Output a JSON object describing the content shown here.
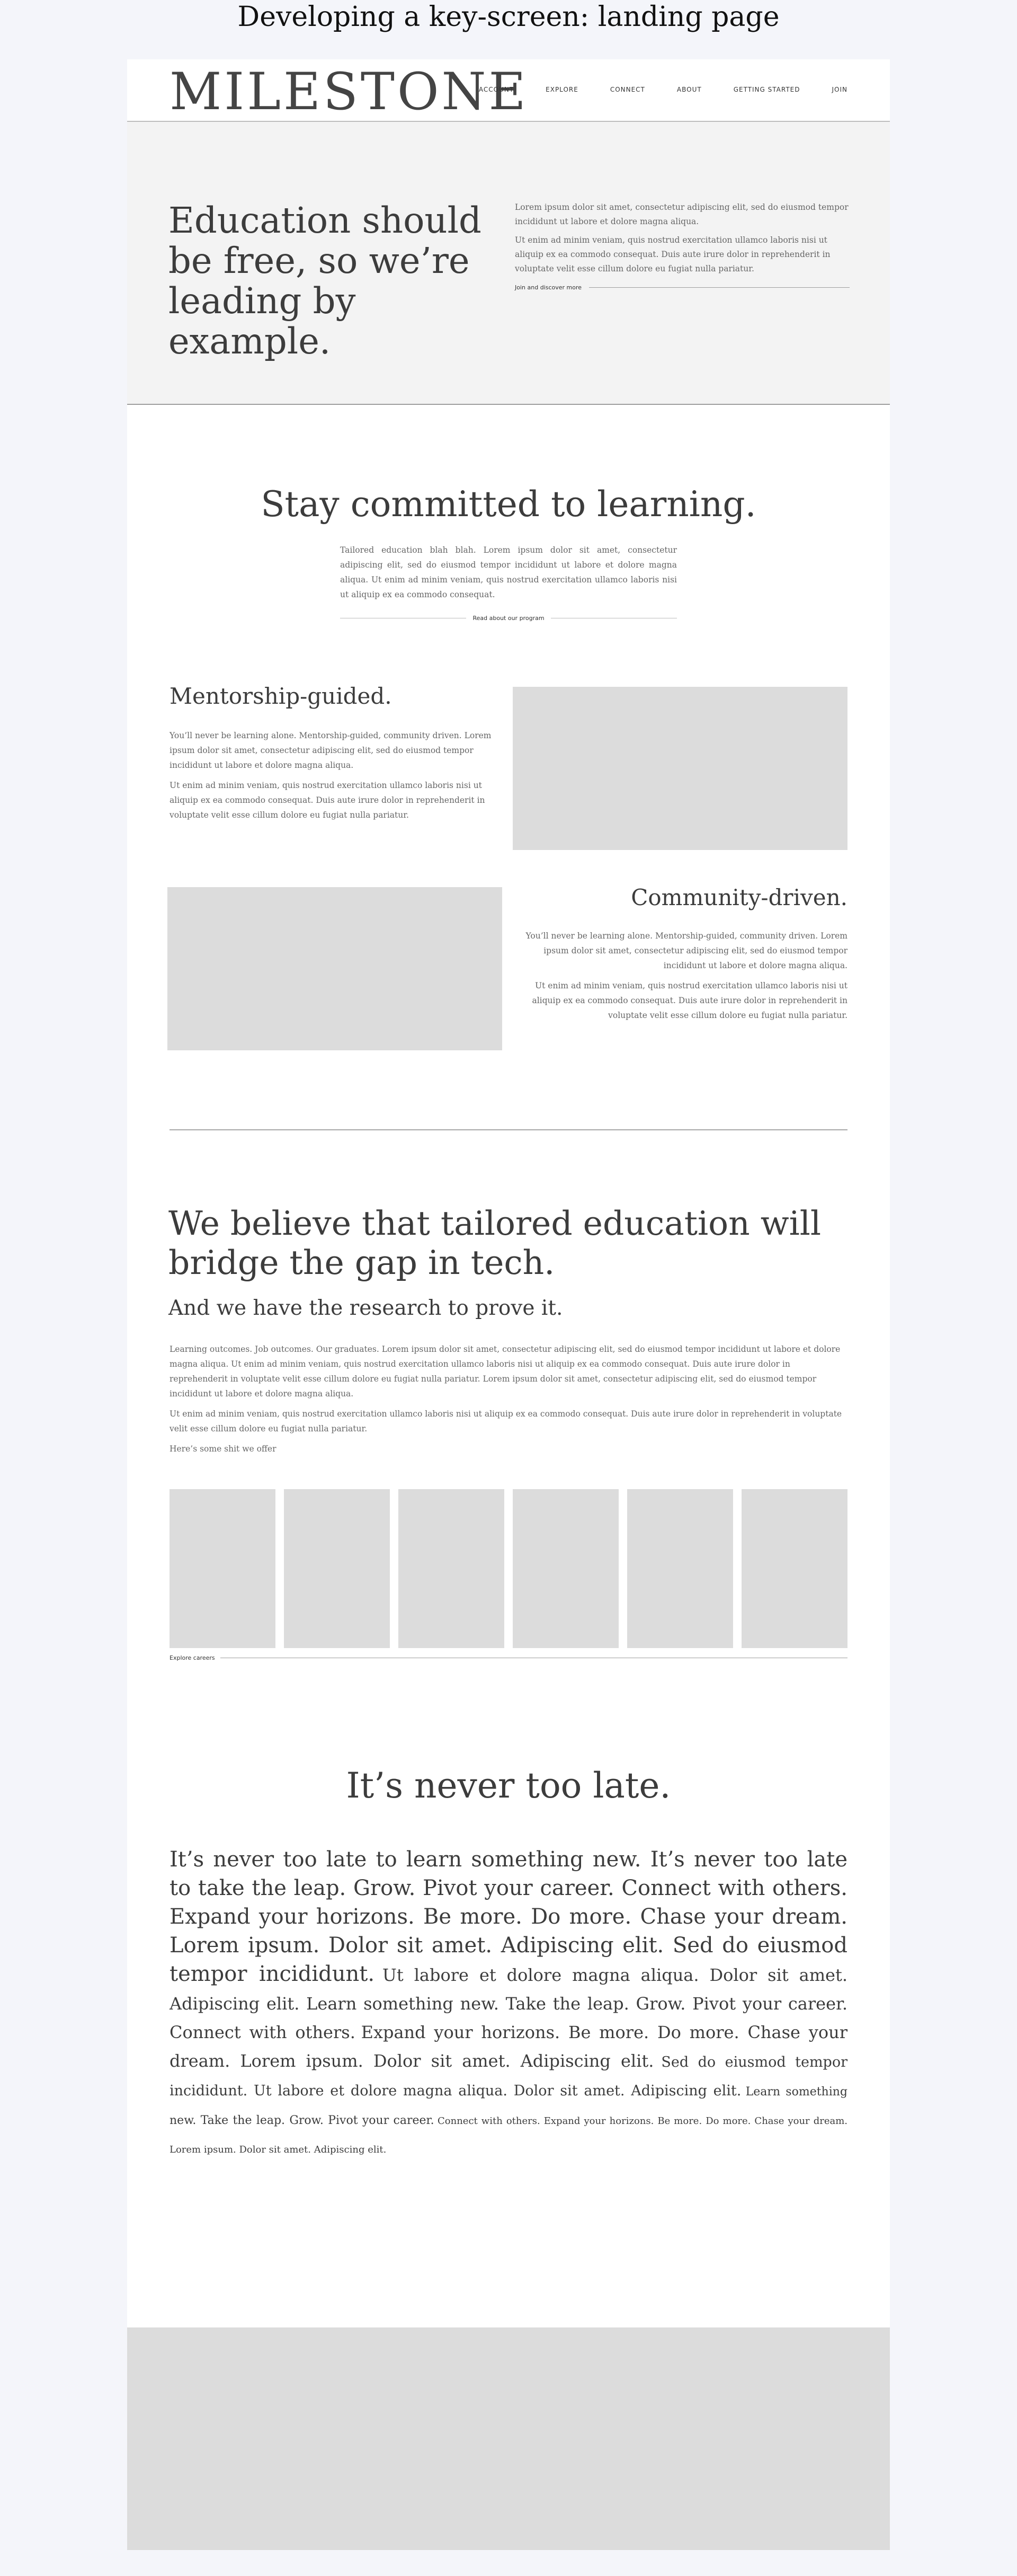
{
  "page_heading": "Developing a key-screen: landing page",
  "header": {
    "logo": "MILESTONE",
    "nav": [
      "ACCOUNT",
      "EXPLORE",
      "CONNECT",
      "ABOUT",
      "GETTING STARTED",
      "JOIN"
    ]
  },
  "hero": {
    "title": "Education should be free, so we’re leading by example.",
    "paragraphs": [
      "Lorem ipsum dolor sit amet, consectetur adipiscing elit, sed do eiusmod tempor incididunt ut labore et dolore magna aliqua.",
      "Ut enim ad minim veniam, quis nostrud exercitation ullamco laboris nisi ut aliquip ex ea commodo consequat. Duis aute irure dolor in reprehenderit in voluptate velit esse cillum dolore eu fugiat nulla pariatur."
    ],
    "link": "Join and discover more"
  },
  "commit": {
    "title": "Stay committed to learning.",
    "copy": "Tailored education blah blah. Lorem ipsum dolor sit amet, consectetur adipiscing elit, sed do eiusmod tempor incididunt ut labore et dolore magna aliqua. Ut enim ad minim veniam, quis nostrud exercitation ullamco laboris nisi ut aliquip ex ea commodo consequat.",
    "link": "Read about our program"
  },
  "features": [
    {
      "title": "Mentorship-guided.",
      "paragraphs": [
        "You’ll never be learning alone. Mentorship-guided, community driven. Lorem ipsum dolor sit amet, consectetur adipiscing elit, sed do eiusmod tempor incididunt ut labore et dolore magna aliqua.",
        "Ut enim ad minim veniam, quis nostrud exercitation ullamco laboris nisi ut aliquip ex ea commodo consequat. Duis aute irure dolor in reprehenderit in voluptate velit esse cillum dolore eu fugiat nulla pariatur."
      ]
    },
    {
      "title": "Community-driven.",
      "paragraphs": [
        "You’ll never be learning alone. Mentorship-guided, community driven. Lorem ipsum dolor sit amet, consectetur adipiscing elit, sed do eiusmod tempor incididunt ut labore et dolore magna aliqua.",
        "Ut enim ad minim veniam, quis nostrud exercitation ullamco laboris nisi ut aliquip ex ea commodo consequat. Duis aute irure dolor in reprehenderit in voluptate velit esse cillum dolore eu fugiat nulla pariatur."
      ]
    }
  ],
  "believe": {
    "title": "We believe that tailored education will bridge the gap in tech.",
    "subtitle": "And we have the research to prove it.",
    "paragraphs": [
      "Learning outcomes. Job outcomes. Our graduates. Lorem ipsum dolor sit amet, consectetur adipiscing elit, sed do eiusmod tempor incididunt ut labore et dolore magna aliqua. Ut enim ad minim veniam, quis nostrud exercitation ullamco laboris nisi ut aliquip ex ea commodo consequat. Duis aute irure dolor in reprehenderit in voluptate velit esse cillum dolore eu fugiat nulla pariatur. Lorem ipsum dolor sit amet, consectetur adipiscing elit, sed do eiusmod tempor incididunt ut labore et dolore magna aliqua.",
      "Ut enim ad minim veniam, quis nostrud exercitation ullamco laboris nisi ut aliquip ex ea commodo consequat. Duis aute irure dolor in reprehenderit in voluptate velit esse cillum dolore eu fugiat nulla pariatur.",
      "Here’s some shit we offer"
    ],
    "card_count": 6,
    "link": "Explore careers"
  },
  "late": {
    "title": "It’s never too late.",
    "segments": [
      "It’s never too late to learn something new. It’s never too late to take the leap. Grow. Pivot your career. Connect with others. Expand your horizons. Be more. Do more. Chase your dream. Lorem ipsum. Dolor sit amet. Adipiscing elit. Sed do eiusmod tempor incididunt.",
      "Ut labore et dolore magna aliqua. Dolor sit amet. Adipiscing elit. Learn something new. Take the leap. Grow. Pivot your career. Connect with others.",
      "Expand your horizons. Be more. Do more. Chase your dream. Lorem ipsum. Dolor sit amet. Adipiscing elit.",
      "Sed do eiusmod tempor incididunt. Ut labore et dolore magna aliqua. Dolor sit amet. Adipiscing elit.",
      "Learn something new. Take the leap. Grow. Pivot your career.",
      "Connect with others. Expand your horizons. Be more. Do more. Chase your dream. Lorem ipsum. Dolor sit amet. Adipiscing elit."
    ]
  },
  "colors": {
    "page_background": "#f4f5fa",
    "frame_background": "#ffffff",
    "hero_background": "#f3f3f3",
    "placeholder": "#dcdcdc",
    "text_dark": "#3c3c3c",
    "text_body": "#666666"
  }
}
